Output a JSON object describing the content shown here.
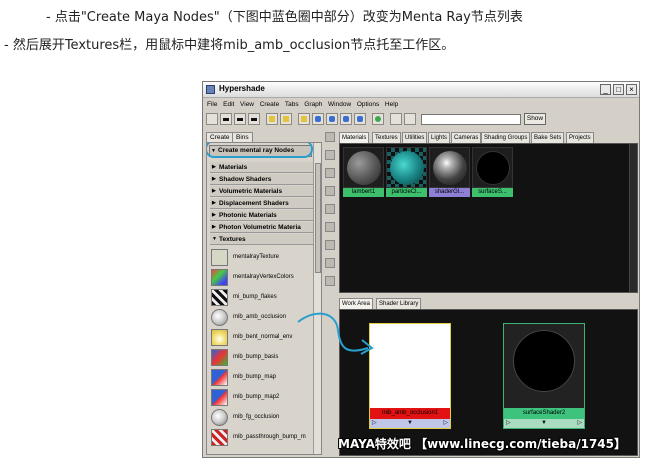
{
  "instructions": {
    "line1": "- 点击\"Create Maya Nodes\"（下图中蓝色圈中部分）改变为Menta Ray节点列表",
    "line2": "- 然后展开Textures栏，用鼠标中建将mib_amb_occlusion节点托至工作区。"
  },
  "window": {
    "title": "Hypershade",
    "minimize": "_",
    "maximize": "□",
    "close": "×"
  },
  "menu": [
    "File",
    "Edit",
    "View",
    "Create",
    "Tabs",
    "Graph",
    "Window",
    "Options",
    "Help"
  ],
  "toolbar": {
    "show_label": "Show"
  },
  "left_tabs": {
    "create": "Create",
    "bins": "Bins"
  },
  "create_header": "Create mental ray Nodes",
  "categories": {
    "materials": "Materials",
    "shadow": "Shadow Shaders",
    "volumetric": "Volumetric Materials",
    "displacement": "Displacement Shaders",
    "photonic": "Photonic Materials",
    "photon_vol": "Photon Volumetric Materia",
    "textures": "Textures"
  },
  "texture_nodes": [
    {
      "label": "mentalrayTexture",
      "icon": "texture-swatch-icon"
    },
    {
      "label": "mentalrayVertexColors",
      "icon": "vertex-colors-icon"
    },
    {
      "label": "mi_bump_flakes",
      "icon": "bump-flakes-icon"
    },
    {
      "label": "mib_amb_occlusion",
      "icon": "amb-occlusion-icon"
    },
    {
      "label": "mib_bent_normal_env",
      "icon": "bent-normal-icon"
    },
    {
      "label": "mib_bump_basis",
      "icon": "bump-basis-icon"
    },
    {
      "label": "mib_bump_map",
      "icon": "bump-map-icon"
    },
    {
      "label": "mib_bump_map2",
      "icon": "bump-map2-icon"
    },
    {
      "label": "mib_fg_occlusion",
      "icon": "fg-occlusion-icon"
    },
    {
      "label": "mib_passthrough_bump_m",
      "icon": "passthrough-bump-icon"
    }
  ],
  "material_tabs": [
    "Materials",
    "Textures",
    "Utilities",
    "Lights",
    "Cameras",
    "Shading Groups",
    "Bake Sets",
    "Projects"
  ],
  "swatches": [
    {
      "label": "lambert1",
      "label_color": "#3dbf6e"
    },
    {
      "label": "particleCl...",
      "label_color": "#3dbf6e"
    },
    {
      "label": "shaderGl...",
      "label_color": "#8d7fd4"
    },
    {
      "label": "surfaceS...",
      "label_color": "#3dbf6e"
    }
  ],
  "work_tabs": {
    "work_area": "Work Area",
    "shader_library": "Shader Library"
  },
  "work_nodes": {
    "occlusion": "mib_amb_occlusion1",
    "surface": "surfaceShader2"
  },
  "watermark": "MAYA特效吧 【www.linecg.com/tieba/1745】",
  "colors": {
    "highlight_circle": "#2a9fcf",
    "drag_arrow": "#2a9fcf"
  }
}
